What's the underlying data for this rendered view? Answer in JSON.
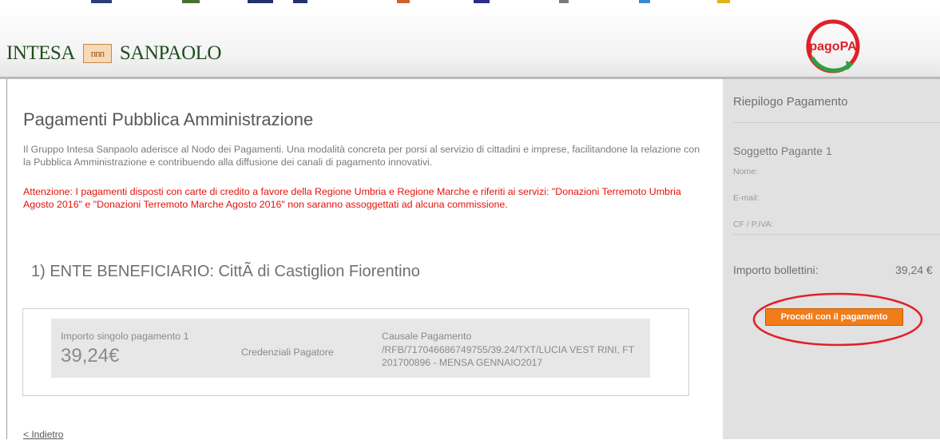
{
  "header": {
    "brand_left": "INTESA",
    "brand_logo": "nnn",
    "brand_right": "SANPAOLO",
    "pagopa_logo": "pagoPA",
    "pagopa_icon": "pagopa-logo"
  },
  "main": {
    "title": "Pagamenti Pubblica Amministrazione",
    "intro": "Il Gruppo Intesa Sanpaolo aderisce al Nodo dei Pagamenti. Una modalità concreta per porsi al servizio di cittadini e imprese, facilitandone la relazione con la Pubblica Amministrazione e contribuendo alla diffusione dei canali di pagamento innovativi.",
    "warning": "Attenzione: I pagamenti disposti con carte di credito a favore della Regione Umbria e Regione Marche e riferiti ai servizi: \"Donazioni Terremoto Umbria Agosto 2016\" e \"Donazioni Terremoto Marche Agosto 2016\" non saranno assoggettati ad alcuna commissione.",
    "ente_heading": "1) ENTE BENEFICIARIO: CittÃ  di Castiglion Fiorentino",
    "payment": {
      "importo_label": "Importo singolo pagamento 1",
      "importo_value": "39,24€",
      "credenziali_label": "Credenziali Pagatore",
      "causale_label": "Causale Pagamento",
      "causale_value": "/RFB/717046686749755/39.24/TXT/LUCIA VEST RINI, FT 201700896 - MENSA GENNAIO2017"
    },
    "back_link": "< Indietro"
  },
  "sidebar": {
    "title": "Riepilogo Pagamento",
    "subject": "Soggetto Pagante 1",
    "nome_label": "Nome:",
    "email_label": "E-mail:",
    "cf_label": "CF / P.IVA:",
    "importo_label": "Importo bollettini:",
    "importo_value": "39,24 €",
    "proceed_label": "Procedi con il pagamento"
  },
  "colors": {
    "accent_orange": "#f07d1a",
    "warning_red": "#e3120b",
    "annotation_red": "#e0202a",
    "brand_green": "#1f4d1f"
  }
}
